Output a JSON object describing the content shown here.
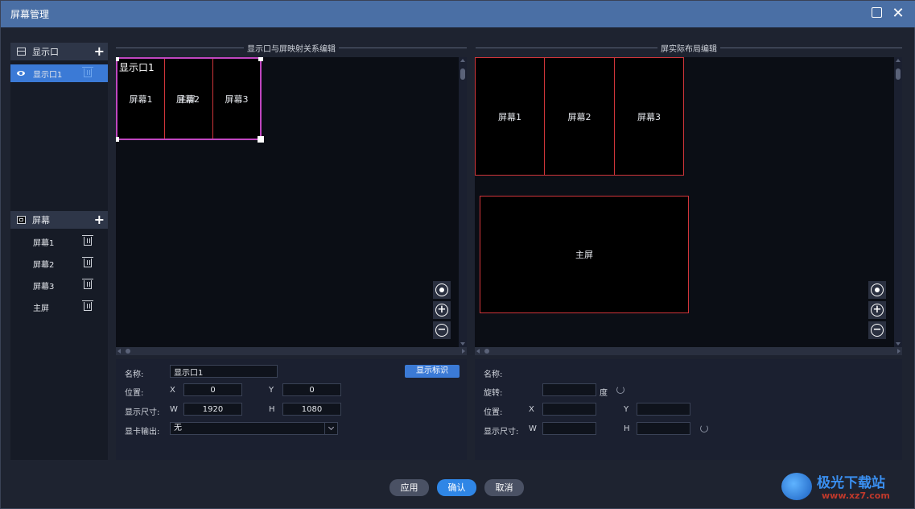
{
  "window": {
    "title": "屏幕管理"
  },
  "sidebar": {
    "windows_section": {
      "label": "显示口",
      "items": [
        {
          "label": "显示口1",
          "selected": true
        }
      ]
    },
    "screens_section": {
      "label": "屏幕",
      "items": [
        {
          "label": "屏幕1"
        },
        {
          "label": "屏幕2"
        },
        {
          "label": "屏幕3"
        },
        {
          "label": "主屏"
        }
      ]
    }
  },
  "left_panel": {
    "legend": "显示口与屏映射关系编辑",
    "region_label": "显示口1",
    "screens": [
      {
        "label": "屏幕1"
      },
      {
        "label": "屏幕2",
        "overlay_label": "主屏"
      },
      {
        "label": "屏幕3"
      }
    ],
    "props": {
      "name_label": "名称:",
      "name_value": "显示口1",
      "show_id_button": "显示标识",
      "position_label": "位置:",
      "x_label": "X",
      "x_value": "0",
      "y_label": "Y",
      "y_value": "0",
      "size_label": "显示尺寸:",
      "w_label": "W",
      "w_value": "1920",
      "h_label": "H",
      "h_value": "1080",
      "output_label": "显卡输出:",
      "output_value": "无"
    }
  },
  "right_panel": {
    "legend": "屏实际布局编辑",
    "screens": [
      {
        "label": "屏幕1"
      },
      {
        "label": "屏幕2"
      },
      {
        "label": "屏幕3"
      }
    ],
    "main_screen": {
      "label": "主屏"
    },
    "props": {
      "name_label": "名称:",
      "rotation_label": "旋转:",
      "rotation_unit": "度",
      "rotation_value": "",
      "position_label": "位置:",
      "x_label": "X",
      "x_value": "",
      "y_label": "Y",
      "y_value": "",
      "size_label": "显示尺寸:",
      "w_label": "W",
      "w_value": "",
      "h_label": "H",
      "h_value": ""
    }
  },
  "footer": {
    "apply": "应用",
    "confirm": "确认",
    "cancel": "取消"
  },
  "watermark": {
    "text": "极光下载站",
    "url": "www.xz7.com"
  },
  "colors": {
    "titlebar": "#4a6fa5",
    "accent": "#3b7ad6",
    "screen_border": "#d0353a",
    "region_border": "#c046c0"
  }
}
